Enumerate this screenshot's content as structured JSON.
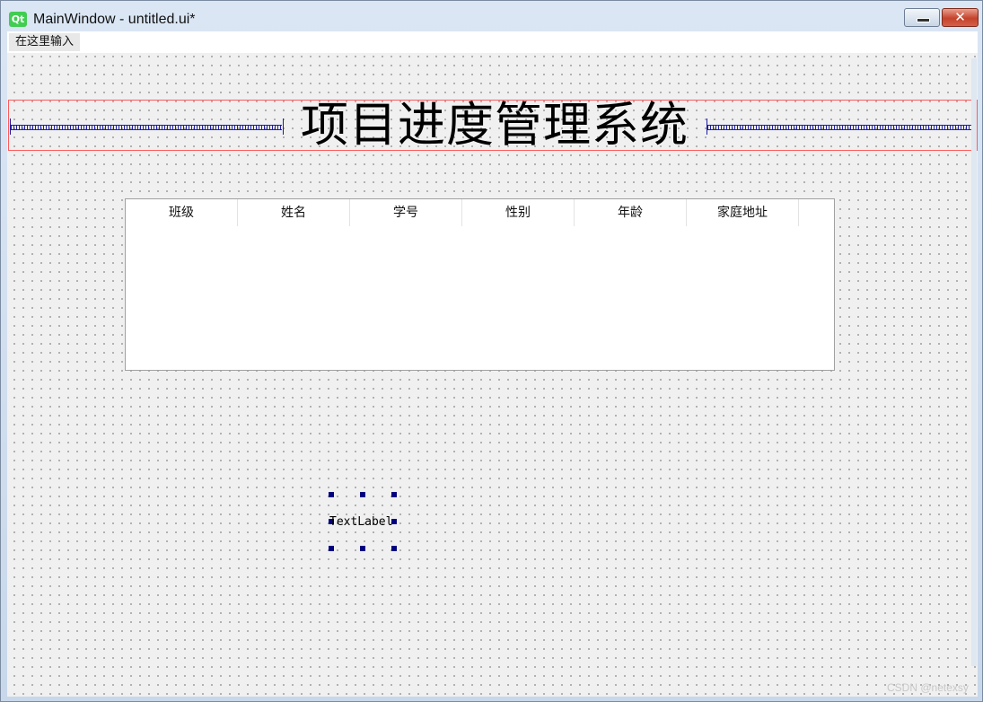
{
  "window": {
    "app_icon": "Qt",
    "title": "MainWindow - untitled.ui*",
    "minimize_icon": "minimize-icon",
    "close_icon": "close-icon",
    "close_glyph": "✕"
  },
  "menubar": {
    "placeholder_item": "在这里输入"
  },
  "heading": {
    "text": "项目进度管理系统"
  },
  "table": {
    "columns": [
      "班级",
      "姓名",
      "学号",
      "性别",
      "年龄",
      "家庭地址"
    ]
  },
  "selected_label": {
    "text": "TextLabel"
  },
  "watermark": {
    "text": "CSDN @netexsy"
  },
  "colors": {
    "layout_border": "#ff5b5b",
    "spacer": "#1c1ca8",
    "selection_handle": "#000080",
    "qt_icon": "#41cd52"
  }
}
